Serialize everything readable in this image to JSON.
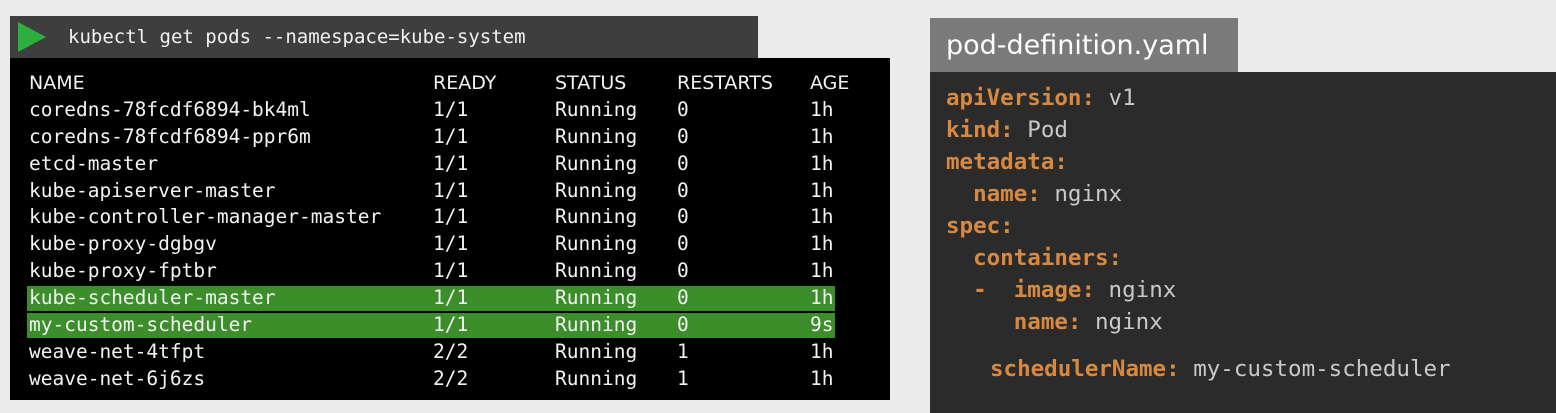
{
  "terminal": {
    "command": "kubectl get pods --namespace=kube-system",
    "headers": {
      "name": "NAME",
      "ready": "READY",
      "status": "STATUS",
      "restarts": "RESTARTS",
      "age": "AGE"
    },
    "rows": [
      {
        "name": "coredns-78fcdf6894-bk4ml",
        "ready": "1/1",
        "status": "Running",
        "restarts": "0",
        "age": "1h",
        "highlighted": false
      },
      {
        "name": "coredns-78fcdf6894-ppr6m",
        "ready": "1/1",
        "status": "Running",
        "restarts": "0",
        "age": "1h",
        "highlighted": false
      },
      {
        "name": "etcd-master",
        "ready": "1/1",
        "status": "Running",
        "restarts": "0",
        "age": "1h",
        "highlighted": false
      },
      {
        "name": "kube-apiserver-master",
        "ready": "1/1",
        "status": "Running",
        "restarts": "0",
        "age": "1h",
        "highlighted": false
      },
      {
        "name": "kube-controller-manager-master",
        "ready": "1/1",
        "status": "Running",
        "restarts": "0",
        "age": "1h",
        "highlighted": false
      },
      {
        "name": "kube-proxy-dgbgv",
        "ready": "1/1",
        "status": "Running",
        "restarts": "0",
        "age": "1h",
        "highlighted": false
      },
      {
        "name": "kube-proxy-fptbr",
        "ready": "1/1",
        "status": "Running",
        "restarts": "0",
        "age": "1h",
        "highlighted": false
      },
      {
        "name": "kube-scheduler-master",
        "ready": "1/1",
        "status": "Running",
        "restarts": "0",
        "age": "1h",
        "highlighted": true
      },
      {
        "name": "my-custom-scheduler",
        "ready": "1/1",
        "status": "Running",
        "restarts": "0",
        "age": "9s",
        "highlighted": true
      },
      {
        "name": "weave-net-4tfpt",
        "ready": "2/2",
        "status": "Running",
        "restarts": "1",
        "age": "1h",
        "highlighted": false
      },
      {
        "name": "weave-net-6j6zs",
        "ready": "2/2",
        "status": "Running",
        "restarts": "1",
        "age": "1h",
        "highlighted": false
      }
    ],
    "play_icon": "play-triangle-icon",
    "highlight_color": "#3b8e2a"
  },
  "yaml": {
    "filename": "pod-definition.yaml",
    "lines": [
      {
        "key": "apiVersion:",
        "value": " v1"
      },
      {
        "key": "kind:",
        "value": " Pod"
      },
      {
        "key": "metadata:",
        "value": ""
      },
      {
        "key": "  name:",
        "value": " nginx"
      },
      {
        "key": "spec:",
        "value": ""
      },
      {
        "key": "  containers:",
        "value": ""
      },
      {
        "key": "  -  image:",
        "value": " nginx"
      },
      {
        "key": "     name:",
        "value": " nginx"
      },
      {
        "key": "schedulerName:",
        "value": " my-custom-scheduler"
      }
    ],
    "key_color": "#d9893f"
  }
}
